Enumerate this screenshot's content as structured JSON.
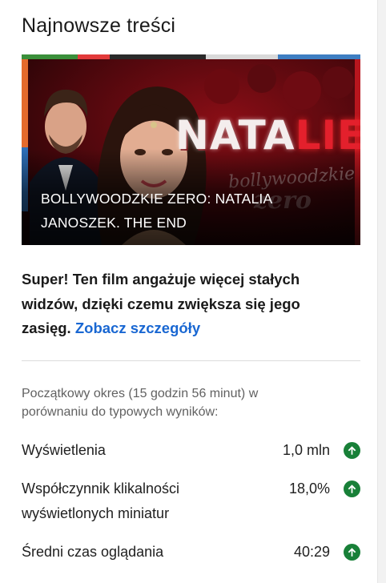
{
  "section": {
    "title": "Najnowsze treści"
  },
  "video": {
    "title": "BOLLYWOODZKIE ZERO: NATALIA JANOSZEK. THE END",
    "thumbnail_text_main": "NATA",
    "thumbnail_text_accent": "LIE",
    "thumbnail_logo_line1": "bollywoodzkie",
    "thumbnail_logo_line2": "zero"
  },
  "insight": {
    "message": "Super! Ten film angażuje więcej stałych widzów, dzięki czemu zwiększa się jego zasięg.",
    "link_label": "Zobacz szczegóły"
  },
  "period": {
    "text": "Początkowy okres (15 godzin 56 minut) w porównaniu do typowych wyników:"
  },
  "metrics": [
    {
      "label": "Wyświetlenia",
      "value": "1,0 mln",
      "trend": "up",
      "icon": "arrow-up-circle-icon"
    },
    {
      "label": "Współczynnik klikalności wyświetlonych miniatur",
      "value": "18,0%",
      "trend": "up",
      "icon": "arrow-up-circle-icon"
    },
    {
      "label": "Średni czas oglądania",
      "value": "40:29",
      "trend": "up",
      "icon": "arrow-up-circle-icon"
    }
  ],
  "colors": {
    "link": "#1967d2",
    "trend_up": "#188038",
    "thumbnail_accent": "#e3202c"
  }
}
